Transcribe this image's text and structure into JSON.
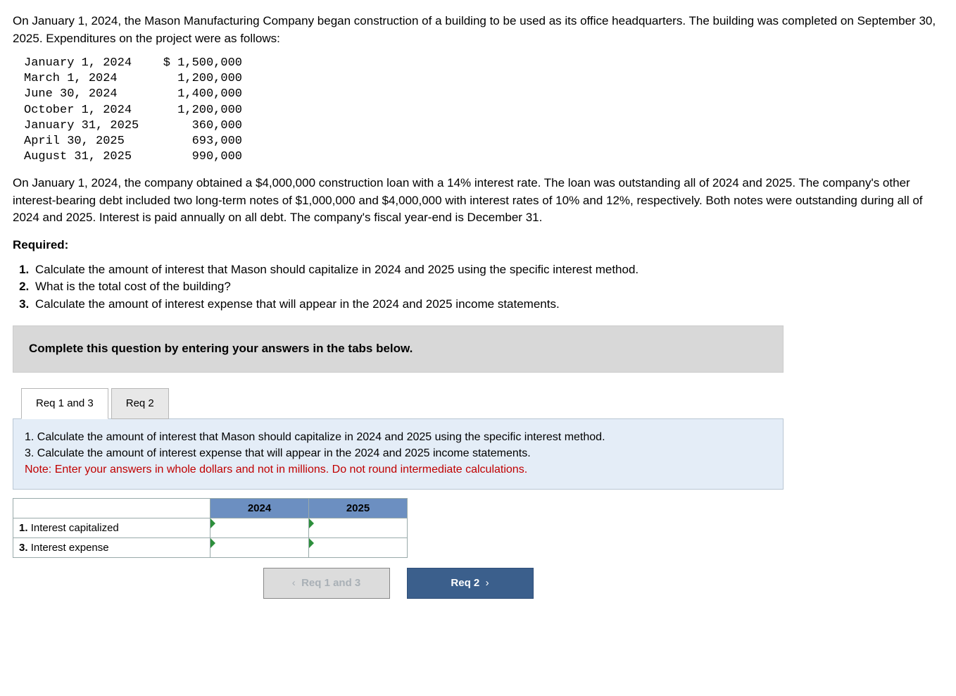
{
  "intro1": "On January 1, 2024, the Mason Manufacturing Company began construction of a building to be used as its office headquarters. The building was completed on September 30, 2025. Expenditures on the project were as follows:",
  "expenditures": [
    {
      "date": "January 1, 2024",
      "amount": "$ 1,500,000"
    },
    {
      "date": "March 1, 2024",
      "amount": "1,200,000"
    },
    {
      "date": "June 30, 2024",
      "amount": "1,400,000"
    },
    {
      "date": "October 1, 2024",
      "amount": "1,200,000"
    },
    {
      "date": "January 31, 2025",
      "amount": "360,000"
    },
    {
      "date": "April 30, 2025",
      "amount": "693,000"
    },
    {
      "date": "August 31, 2025",
      "amount": "990,000"
    }
  ],
  "intro2": "On January 1, 2024, the company obtained a $4,000,000 construction loan with a 14% interest rate. The loan was outstanding all of 2024 and 2025. The company's other interest-bearing debt included two long-term notes of $1,000,000 and $4,000,000 with interest rates of 10% and 12%, respectively. Both notes were outstanding during all of 2024 and 2025. Interest is paid annually on all debt. The company's fiscal year-end is December 31.",
  "required_label": "Required:",
  "requirements": [
    "Calculate the amount of interest that Mason should capitalize in 2024 and 2025 using the specific interest method.",
    "What is the total cost of the building?",
    "Calculate the amount of interest expense that will appear in the 2024 and 2025 income statements."
  ],
  "instruction_bar": "Complete this question by entering your answers in the tabs below.",
  "tabs": {
    "t1": "Req 1 and 3",
    "t2": "Req 2"
  },
  "panel": {
    "line1": "1. Calculate the amount of interest that Mason should capitalize in 2024 and 2025 using the specific interest method.",
    "line3": "3. Calculate the amount of interest expense that will appear in the 2024 and 2025 income statements.",
    "note": "Note: Enter your answers in whole dollars and not in millions. Do not round intermediate calculations."
  },
  "table": {
    "col1": "2024",
    "col2": "2025",
    "row1": "1. Interest capitalized",
    "row3": "3. Interest expense"
  },
  "nav": {
    "prev": "Req 1 and 3",
    "next": "Req 2"
  }
}
